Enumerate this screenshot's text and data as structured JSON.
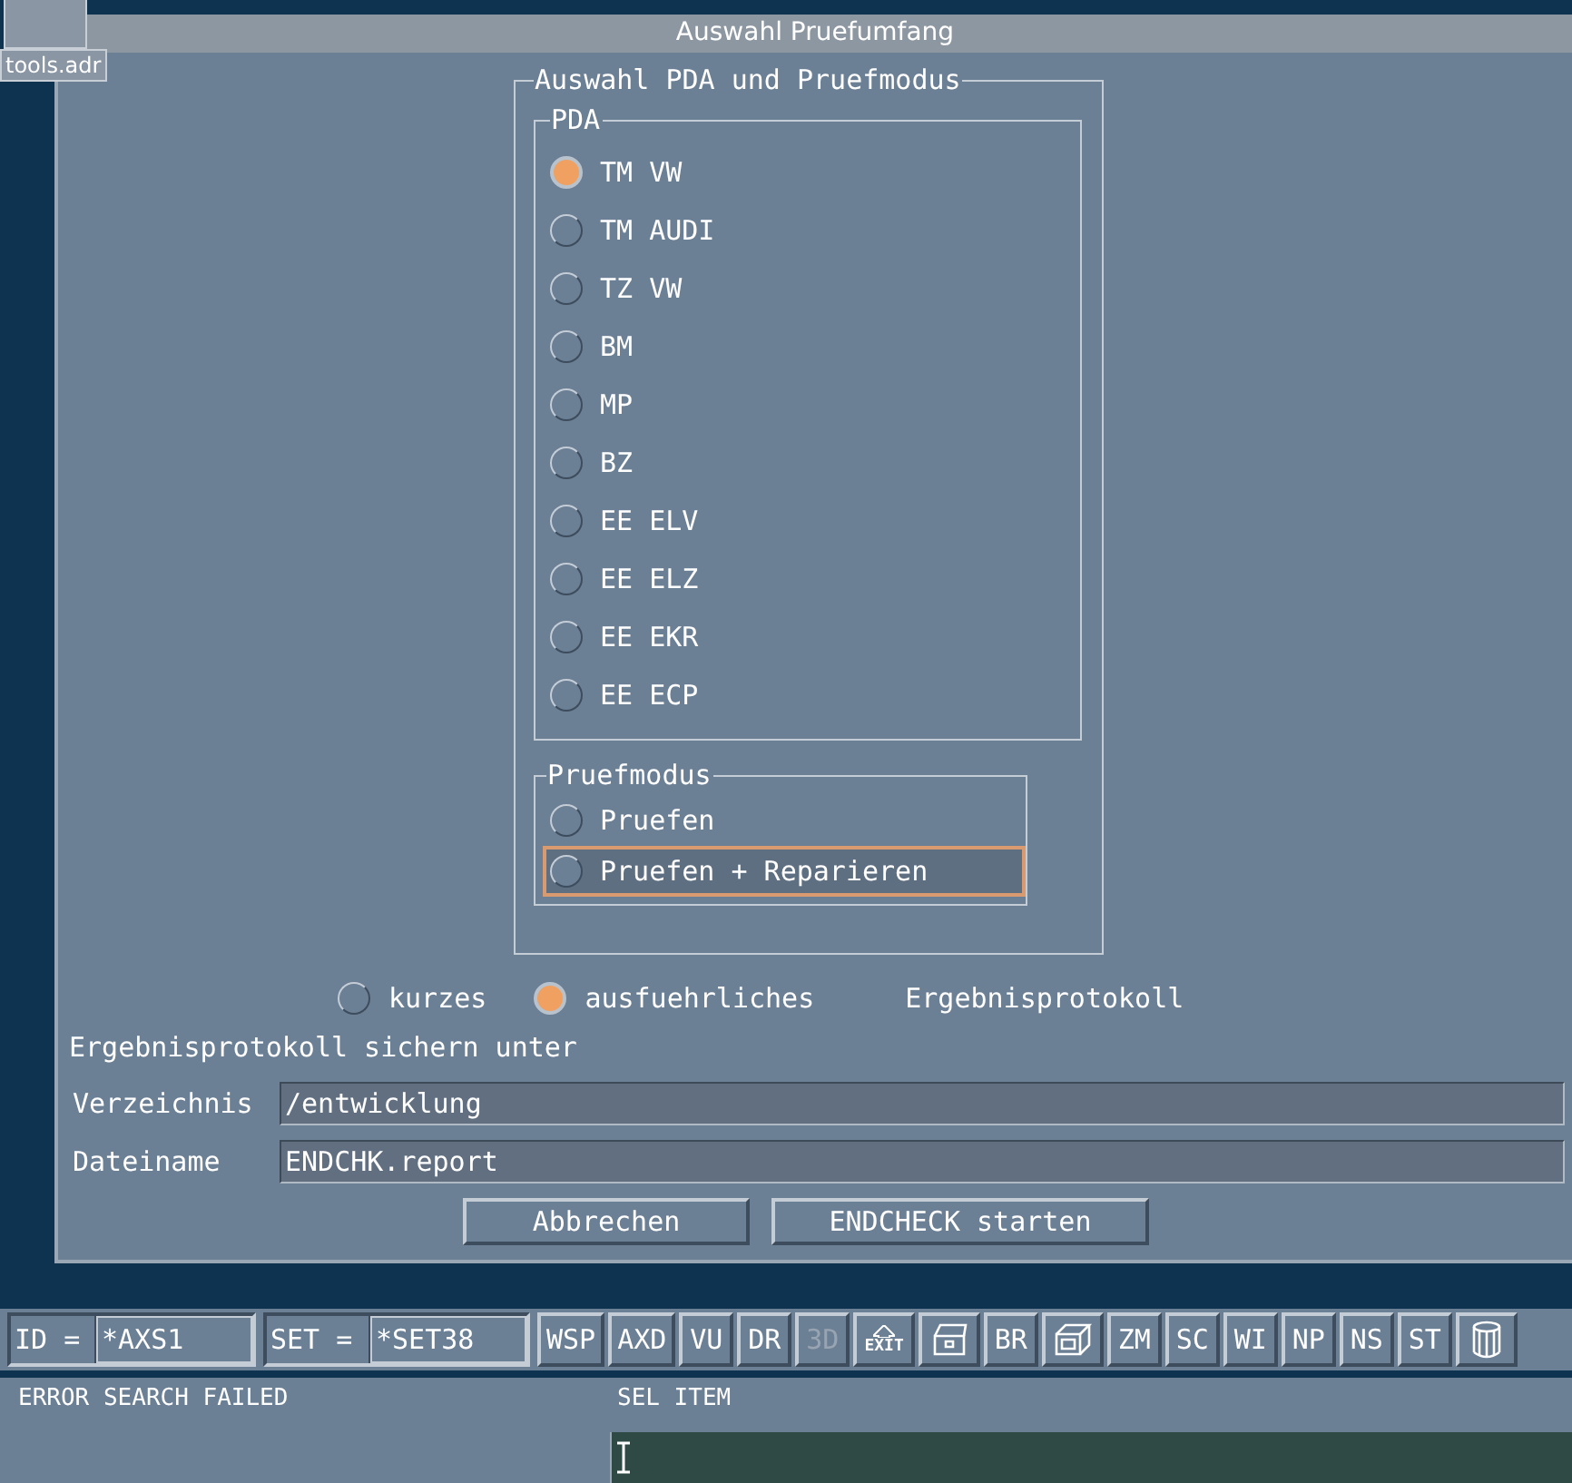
{
  "desktop_icon": {
    "label": "tools.adr"
  },
  "window": {
    "title": "Auswahl Pruefumfang"
  },
  "main_group": {
    "title": "Auswahl PDA und Pruefmodus",
    "pda": {
      "title": "PDA",
      "options": [
        {
          "label": "TM VW",
          "selected": true
        },
        {
          "label": "TM AUDI",
          "selected": false
        },
        {
          "label": "TZ VW",
          "selected": false
        },
        {
          "label": "BM",
          "selected": false
        },
        {
          "label": "MP",
          "selected": false
        },
        {
          "label": "BZ",
          "selected": false
        },
        {
          "label": "EE ELV",
          "selected": false
        },
        {
          "label": "EE ELZ",
          "selected": false
        },
        {
          "label": "EE EKR",
          "selected": false
        },
        {
          "label": "EE ECP",
          "selected": false
        }
      ]
    },
    "mode": {
      "title": "Pruefmodus",
      "options": [
        {
          "label": "Pruefen",
          "selected": false,
          "focused": false
        },
        {
          "label": "Pruefen + Reparieren",
          "selected": false,
          "focused": true
        }
      ]
    }
  },
  "protocol": {
    "options": [
      {
        "label": "kurzes",
        "selected": false
      },
      {
        "label": "ausfuehrliches",
        "selected": true
      }
    ],
    "label": "Ergebnisprotokoll"
  },
  "save_title": "Ergebnisprotokoll sichern unter",
  "fields": [
    {
      "label": "Verzeichnis",
      "value": "/entwicklung"
    },
    {
      "label": "Dateiname",
      "value": "ENDCHK.report"
    }
  ],
  "buttons": [
    "Abbrechen",
    "ENDCHECK starten"
  ],
  "toolbar": [
    {
      "kind": "field",
      "label": "ID =",
      "value": "*AXS1"
    },
    {
      "kind": "field",
      "label": "SET =",
      "value": "*SET38"
    },
    {
      "kind": "button",
      "label": "WSP",
      "disabled": false
    },
    {
      "kind": "button",
      "label": "AXD",
      "disabled": false
    },
    {
      "kind": "button",
      "label": "VU",
      "disabled": false
    },
    {
      "kind": "button",
      "label": "DR",
      "disabled": false
    },
    {
      "kind": "button",
      "label": "3D",
      "disabled": true
    },
    {
      "kind": "exit",
      "label": "EXIT"
    },
    {
      "kind": "chest"
    },
    {
      "kind": "button",
      "label": "BR",
      "disabled": false
    },
    {
      "kind": "box"
    },
    {
      "kind": "button",
      "label": "ZM",
      "disabled": false
    },
    {
      "kind": "button",
      "label": "SC",
      "disabled": false
    },
    {
      "kind": "button",
      "label": "WI",
      "disabled": false
    },
    {
      "kind": "button",
      "label": "NP",
      "disabled": false
    },
    {
      "kind": "button",
      "label": "NS",
      "disabled": false
    },
    {
      "kind": "button",
      "label": "ST",
      "disabled": false
    },
    {
      "kind": "cylinder"
    }
  ],
  "status": {
    "message": "ERROR SEARCH FAILED",
    "prompt": "SEL ITEM"
  }
}
